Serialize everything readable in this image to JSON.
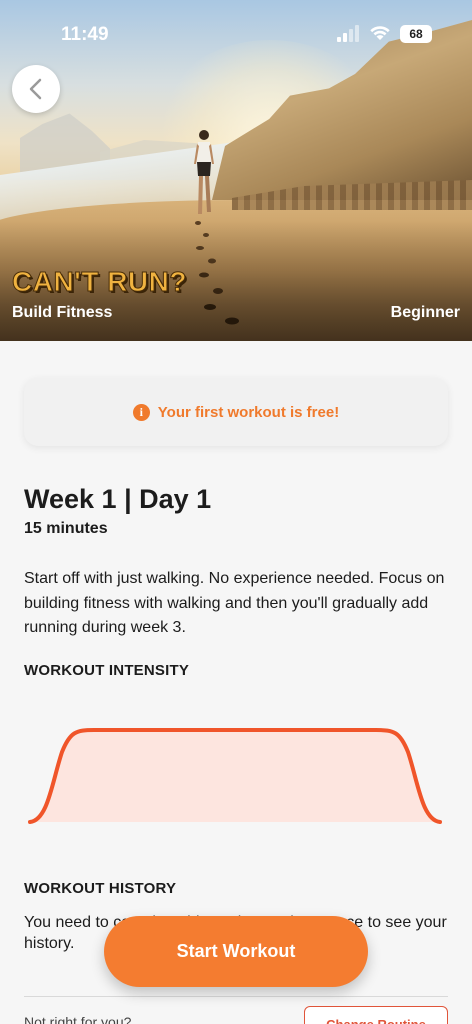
{
  "status_bar": {
    "time": "11:49",
    "battery": "68"
  },
  "hero": {
    "title": "CAN'T RUN?",
    "subtitle": "Build Fitness",
    "level": "Beginner"
  },
  "banner": {
    "text": "Your first workout is free!"
  },
  "workout": {
    "title": "Week 1 | Day 1",
    "duration": "15 minutes",
    "description": "Start off with just walking. No experience needed. Focus on building fitness with walking and then you'll gradually add running during week 3."
  },
  "intensity": {
    "label": "WORKOUT INTENSITY",
    "accent_color": "#f0552a",
    "fill_color": "#fde5df"
  },
  "history": {
    "label": "WORKOUT HISTORY",
    "text": "You need to complete this workout at least once to see your history."
  },
  "footer": {
    "prompt": "Not right for you?",
    "change_label": "Change Routine"
  },
  "start_button": {
    "label": "Start Workout",
    "color": "#f47c30"
  },
  "icons": [
    "back-chevron-icon",
    "info-icon",
    "signal-icon",
    "wifi-icon",
    "battery-icon"
  ]
}
